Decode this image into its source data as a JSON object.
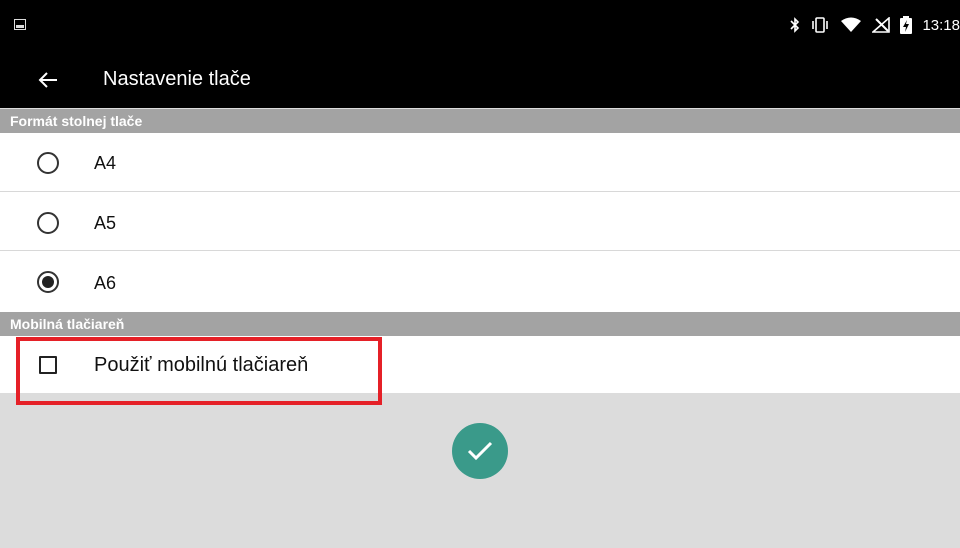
{
  "status_bar": {
    "time": "13:18",
    "icons": [
      "gallery-notification-icon",
      "bluetooth-icon",
      "vibrate-icon",
      "wifi-icon",
      "no-signal-icon",
      "battery-charging-icon"
    ]
  },
  "app_bar": {
    "title": "Nastavenie tlače",
    "back_icon": "arrow-left-icon"
  },
  "sections": [
    {
      "header": "Formát stolnej tlače",
      "options": [
        {
          "label": "A4",
          "selected": false
        },
        {
          "label": "A5",
          "selected": false
        },
        {
          "label": "A6",
          "selected": true
        }
      ]
    },
    {
      "header": "Mobilná tlačiareň",
      "checkbox": {
        "label": "Použiť mobilnú tlačiareň",
        "checked": false
      }
    }
  ],
  "confirm_button": {
    "icon": "checkmark-icon"
  },
  "colors": {
    "bar": "#000000",
    "section_header": "#a3a3a3",
    "accent": "#3a9a8a",
    "highlight": "#e52027",
    "background": "#dcdcdc"
  }
}
